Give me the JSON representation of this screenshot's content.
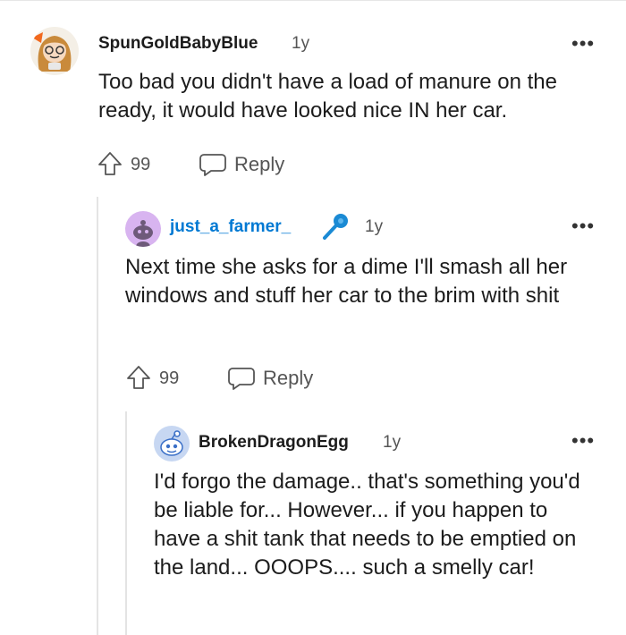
{
  "comments": [
    {
      "username": "SpunGoldBabyBlue",
      "age": "1y",
      "more": "•••",
      "text": "Too bad you didn't have a load of manure on the ready, it would have looked nice IN her car.",
      "votes": "99",
      "reply_label": "Reply",
      "avatar_icon": "girl-avatar-icon"
    },
    {
      "username": "just_a_farmer_",
      "age": "1y",
      "more": "•••",
      "text": "Next time she asks for a dime I'll smash all her windows and stuff her car to the brim with shit",
      "votes": "99",
      "reply_label": "Reply",
      "avatar_icon": "snoo-avatar-icon",
      "flair_icon": "microphone-icon",
      "username_color": "#0079d3"
    },
    {
      "username": "BrokenDragonEgg",
      "age": "1y",
      "more": "•••",
      "text": "I'd forgo the damage.. that's something you'd be liable for... However... if you happen to have a shit tank that needs to be emptied on the land... OOOPS.... such a smelly car!",
      "avatar_icon": "snoo-avatar-icon"
    }
  ],
  "colors": {
    "accent_blue": "#0079d3",
    "text_gray": "#555555",
    "thread_line": "#e4e4e4"
  }
}
